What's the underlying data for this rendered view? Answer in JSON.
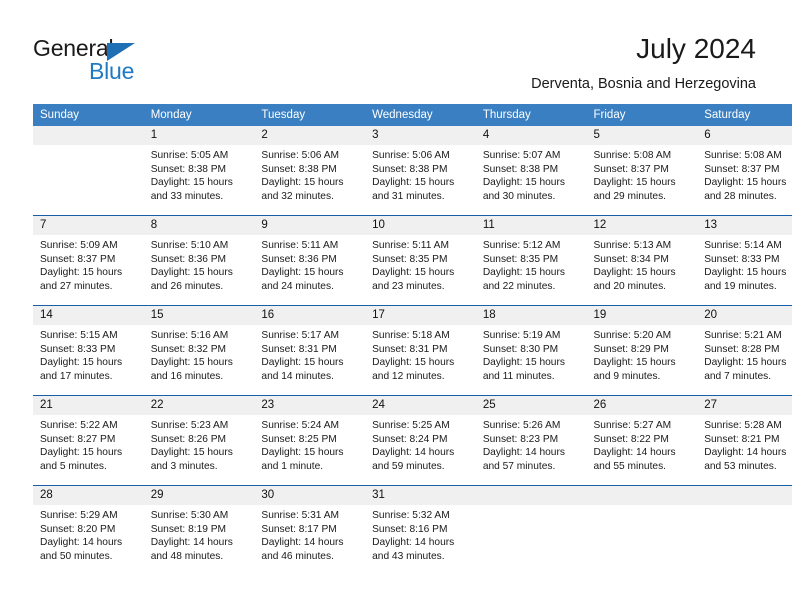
{
  "brand": {
    "name_part1": "General",
    "name_part2": "Blue",
    "triangle_icon": "triangle-logo-icon",
    "accent_color": "#1f7ac4"
  },
  "header": {
    "title": "July 2024",
    "subtitle": "Derventa, Bosnia and Herzegovina"
  },
  "calendar": {
    "header_bg": "#3a7fc1",
    "daynum_bg": "#f0f0f0",
    "row_border": "#195fa8",
    "weekday_headers": [
      "Sunday",
      "Monday",
      "Tuesday",
      "Wednesday",
      "Thursday",
      "Friday",
      "Saturday"
    ],
    "weeks": [
      [
        {
          "day": "",
          "lines": []
        },
        {
          "day": "1",
          "lines": [
            "Sunrise: 5:05 AM",
            "Sunset: 8:38 PM",
            "Daylight: 15 hours",
            "and 33 minutes."
          ]
        },
        {
          "day": "2",
          "lines": [
            "Sunrise: 5:06 AM",
            "Sunset: 8:38 PM",
            "Daylight: 15 hours",
            "and 32 minutes."
          ]
        },
        {
          "day": "3",
          "lines": [
            "Sunrise: 5:06 AM",
            "Sunset: 8:38 PM",
            "Daylight: 15 hours",
            "and 31 minutes."
          ]
        },
        {
          "day": "4",
          "lines": [
            "Sunrise: 5:07 AM",
            "Sunset: 8:38 PM",
            "Daylight: 15 hours",
            "and 30 minutes."
          ]
        },
        {
          "day": "5",
          "lines": [
            "Sunrise: 5:08 AM",
            "Sunset: 8:37 PM",
            "Daylight: 15 hours",
            "and 29 minutes."
          ]
        },
        {
          "day": "6",
          "lines": [
            "Sunrise: 5:08 AM",
            "Sunset: 8:37 PM",
            "Daylight: 15 hours",
            "and 28 minutes."
          ]
        }
      ],
      [
        {
          "day": "7",
          "lines": [
            "Sunrise: 5:09 AM",
            "Sunset: 8:37 PM",
            "Daylight: 15 hours",
            "and 27 minutes."
          ]
        },
        {
          "day": "8",
          "lines": [
            "Sunrise: 5:10 AM",
            "Sunset: 8:36 PM",
            "Daylight: 15 hours",
            "and 26 minutes."
          ]
        },
        {
          "day": "9",
          "lines": [
            "Sunrise: 5:11 AM",
            "Sunset: 8:36 PM",
            "Daylight: 15 hours",
            "and 24 minutes."
          ]
        },
        {
          "day": "10",
          "lines": [
            "Sunrise: 5:11 AM",
            "Sunset: 8:35 PM",
            "Daylight: 15 hours",
            "and 23 minutes."
          ]
        },
        {
          "day": "11",
          "lines": [
            "Sunrise: 5:12 AM",
            "Sunset: 8:35 PM",
            "Daylight: 15 hours",
            "and 22 minutes."
          ]
        },
        {
          "day": "12",
          "lines": [
            "Sunrise: 5:13 AM",
            "Sunset: 8:34 PM",
            "Daylight: 15 hours",
            "and 20 minutes."
          ]
        },
        {
          "day": "13",
          "lines": [
            "Sunrise: 5:14 AM",
            "Sunset: 8:33 PM",
            "Daylight: 15 hours",
            "and 19 minutes."
          ]
        }
      ],
      [
        {
          "day": "14",
          "lines": [
            "Sunrise: 5:15 AM",
            "Sunset: 8:33 PM",
            "Daylight: 15 hours",
            "and 17 minutes."
          ]
        },
        {
          "day": "15",
          "lines": [
            "Sunrise: 5:16 AM",
            "Sunset: 8:32 PM",
            "Daylight: 15 hours",
            "and 16 minutes."
          ]
        },
        {
          "day": "16",
          "lines": [
            "Sunrise: 5:17 AM",
            "Sunset: 8:31 PM",
            "Daylight: 15 hours",
            "and 14 minutes."
          ]
        },
        {
          "day": "17",
          "lines": [
            "Sunrise: 5:18 AM",
            "Sunset: 8:31 PM",
            "Daylight: 15 hours",
            "and 12 minutes."
          ]
        },
        {
          "day": "18",
          "lines": [
            "Sunrise: 5:19 AM",
            "Sunset: 8:30 PM",
            "Daylight: 15 hours",
            "and 11 minutes."
          ]
        },
        {
          "day": "19",
          "lines": [
            "Sunrise: 5:20 AM",
            "Sunset: 8:29 PM",
            "Daylight: 15 hours",
            "and 9 minutes."
          ]
        },
        {
          "day": "20",
          "lines": [
            "Sunrise: 5:21 AM",
            "Sunset: 8:28 PM",
            "Daylight: 15 hours",
            "and 7 minutes."
          ]
        }
      ],
      [
        {
          "day": "21",
          "lines": [
            "Sunrise: 5:22 AM",
            "Sunset: 8:27 PM",
            "Daylight: 15 hours",
            "and 5 minutes."
          ]
        },
        {
          "day": "22",
          "lines": [
            "Sunrise: 5:23 AM",
            "Sunset: 8:26 PM",
            "Daylight: 15 hours",
            "and 3 minutes."
          ]
        },
        {
          "day": "23",
          "lines": [
            "Sunrise: 5:24 AM",
            "Sunset: 8:25 PM",
            "Daylight: 15 hours",
            "and 1 minute."
          ]
        },
        {
          "day": "24",
          "lines": [
            "Sunrise: 5:25 AM",
            "Sunset: 8:24 PM",
            "Daylight: 14 hours",
            "and 59 minutes."
          ]
        },
        {
          "day": "25",
          "lines": [
            "Sunrise: 5:26 AM",
            "Sunset: 8:23 PM",
            "Daylight: 14 hours",
            "and 57 minutes."
          ]
        },
        {
          "day": "26",
          "lines": [
            "Sunrise: 5:27 AM",
            "Sunset: 8:22 PM",
            "Daylight: 14 hours",
            "and 55 minutes."
          ]
        },
        {
          "day": "27",
          "lines": [
            "Sunrise: 5:28 AM",
            "Sunset: 8:21 PM",
            "Daylight: 14 hours",
            "and 53 minutes."
          ]
        }
      ],
      [
        {
          "day": "28",
          "lines": [
            "Sunrise: 5:29 AM",
            "Sunset: 8:20 PM",
            "Daylight: 14 hours",
            "and 50 minutes."
          ]
        },
        {
          "day": "29",
          "lines": [
            "Sunrise: 5:30 AM",
            "Sunset: 8:19 PM",
            "Daylight: 14 hours",
            "and 48 minutes."
          ]
        },
        {
          "day": "30",
          "lines": [
            "Sunrise: 5:31 AM",
            "Sunset: 8:17 PM",
            "Daylight: 14 hours",
            "and 46 minutes."
          ]
        },
        {
          "day": "31",
          "lines": [
            "Sunrise: 5:32 AM",
            "Sunset: 8:16 PM",
            "Daylight: 14 hours",
            "and 43 minutes."
          ]
        },
        {
          "day": "",
          "lines": []
        },
        {
          "day": "",
          "lines": []
        },
        {
          "day": "",
          "lines": []
        }
      ]
    ]
  }
}
